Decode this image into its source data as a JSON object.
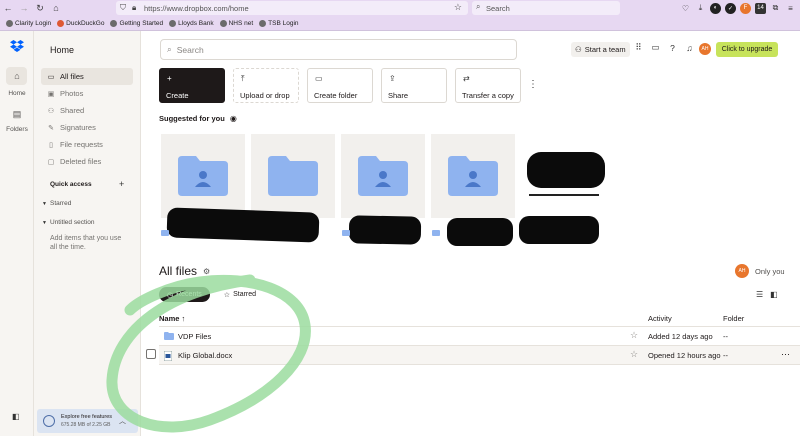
{
  "browser": {
    "url": "https://www.dropbox.com/home",
    "search_placeholder": "Search",
    "badge_count": "14",
    "avatar_label": "F",
    "bookmarks": [
      "Clarity Login",
      "DuckDuckGo",
      "Getting Started",
      "Lloyds Bank",
      "NHS net",
      "TSB Login"
    ]
  },
  "rail": {
    "home_label": "Home",
    "folders_label": "Folders"
  },
  "sidebar": {
    "title": "Home",
    "nav": [
      {
        "label": "All files",
        "icon": "folder-icon",
        "active": true
      },
      {
        "label": "Photos",
        "icon": "photo-icon"
      },
      {
        "label": "Shared",
        "icon": "shared-icon"
      },
      {
        "label": "Signatures",
        "icon": "signature-icon"
      },
      {
        "label": "File requests",
        "icon": "file-request-icon"
      },
      {
        "label": "Deleted files",
        "icon": "trash-icon"
      }
    ],
    "quick_access": "Quick access",
    "starred": "Starred",
    "untitled_section": "Untitled section",
    "help_text": "Add items that you use all the time.",
    "promo_title": "Explore free features",
    "promo_usage": "675.28 MB of 2.25 GB"
  },
  "header": {
    "search_placeholder": "Search",
    "start_team": "Start a team",
    "avatar": "AH",
    "upgrade": "Click to upgrade"
  },
  "actions": [
    {
      "label": "Create",
      "icon": "plus-icon"
    },
    {
      "label": "Upload or drop",
      "icon": "upload-icon"
    },
    {
      "label": "Create folder",
      "icon": "folder-plus-icon"
    },
    {
      "label": "Share",
      "icon": "share-icon"
    },
    {
      "label": "Transfer a copy",
      "icon": "transfer-icon"
    }
  ],
  "suggested": {
    "title": "Suggested for you"
  },
  "files": {
    "title": "All files",
    "owner_avatar": "AH",
    "owner_label": "Only you",
    "filter_recents": "Recents",
    "filter_starred": "Starred",
    "col_name": "Name",
    "col_activity": "Activity",
    "col_folder": "Folder",
    "rows": [
      {
        "name": "VDP Files",
        "activity": "Added 12 days ago",
        "folder": "--"
      },
      {
        "name": "Klip Global.docx",
        "activity": "Opened 12 hours ago",
        "folder": "--"
      }
    ]
  },
  "colors": {
    "upgrade_bg": "#c7e35b",
    "avatar_bg": "#e8762d",
    "folder_blue": "#8fb3ef",
    "browser_chrome": "#e7d8f2"
  }
}
